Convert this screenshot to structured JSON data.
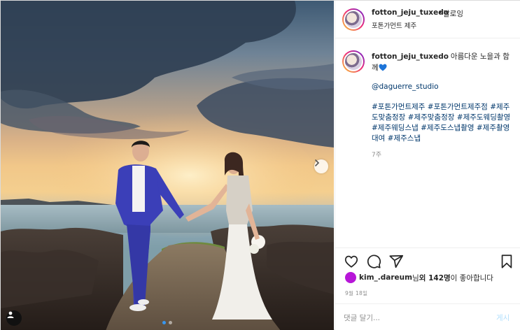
{
  "post": {
    "username": "fotton_jeju_tuxedo",
    "follow_separator": "•",
    "follow_label": "팔로잉",
    "location": "포톤가먼트 제주",
    "caption_text": "아름다운 노을과 함 께",
    "caption_emoji": "blue-heart-icon",
    "mention": "@daguerre_studio",
    "hashtags": [
      "#포톤가먼트제주",
      "#포톤가먼트제주점",
      "#제주도맞춤정장",
      "#제주맞춤정장",
      "#제주도웨딩촬영",
      "#제주웨딩스냅",
      "#제주도스냅촬영",
      "#제주촬영대여",
      "#제주스냅"
    ],
    "time_ago": "7주",
    "likes": {
      "liker": "kim_.dareum",
      "text_mid": "님 ",
      "others": "외 142명",
      "text_end": "이 좋아합니다"
    },
    "date": "9월 18일",
    "comment_placeholder": "댓글 달기...",
    "post_button": "게시"
  },
  "carousel": {
    "current": 1,
    "total": 2,
    "active_dot_color": "#3897f0"
  },
  "icons": [
    "heart-icon",
    "comment-icon",
    "share-icon",
    "bookmark-icon",
    "chevron-right-icon",
    "person-tag-icon"
  ]
}
